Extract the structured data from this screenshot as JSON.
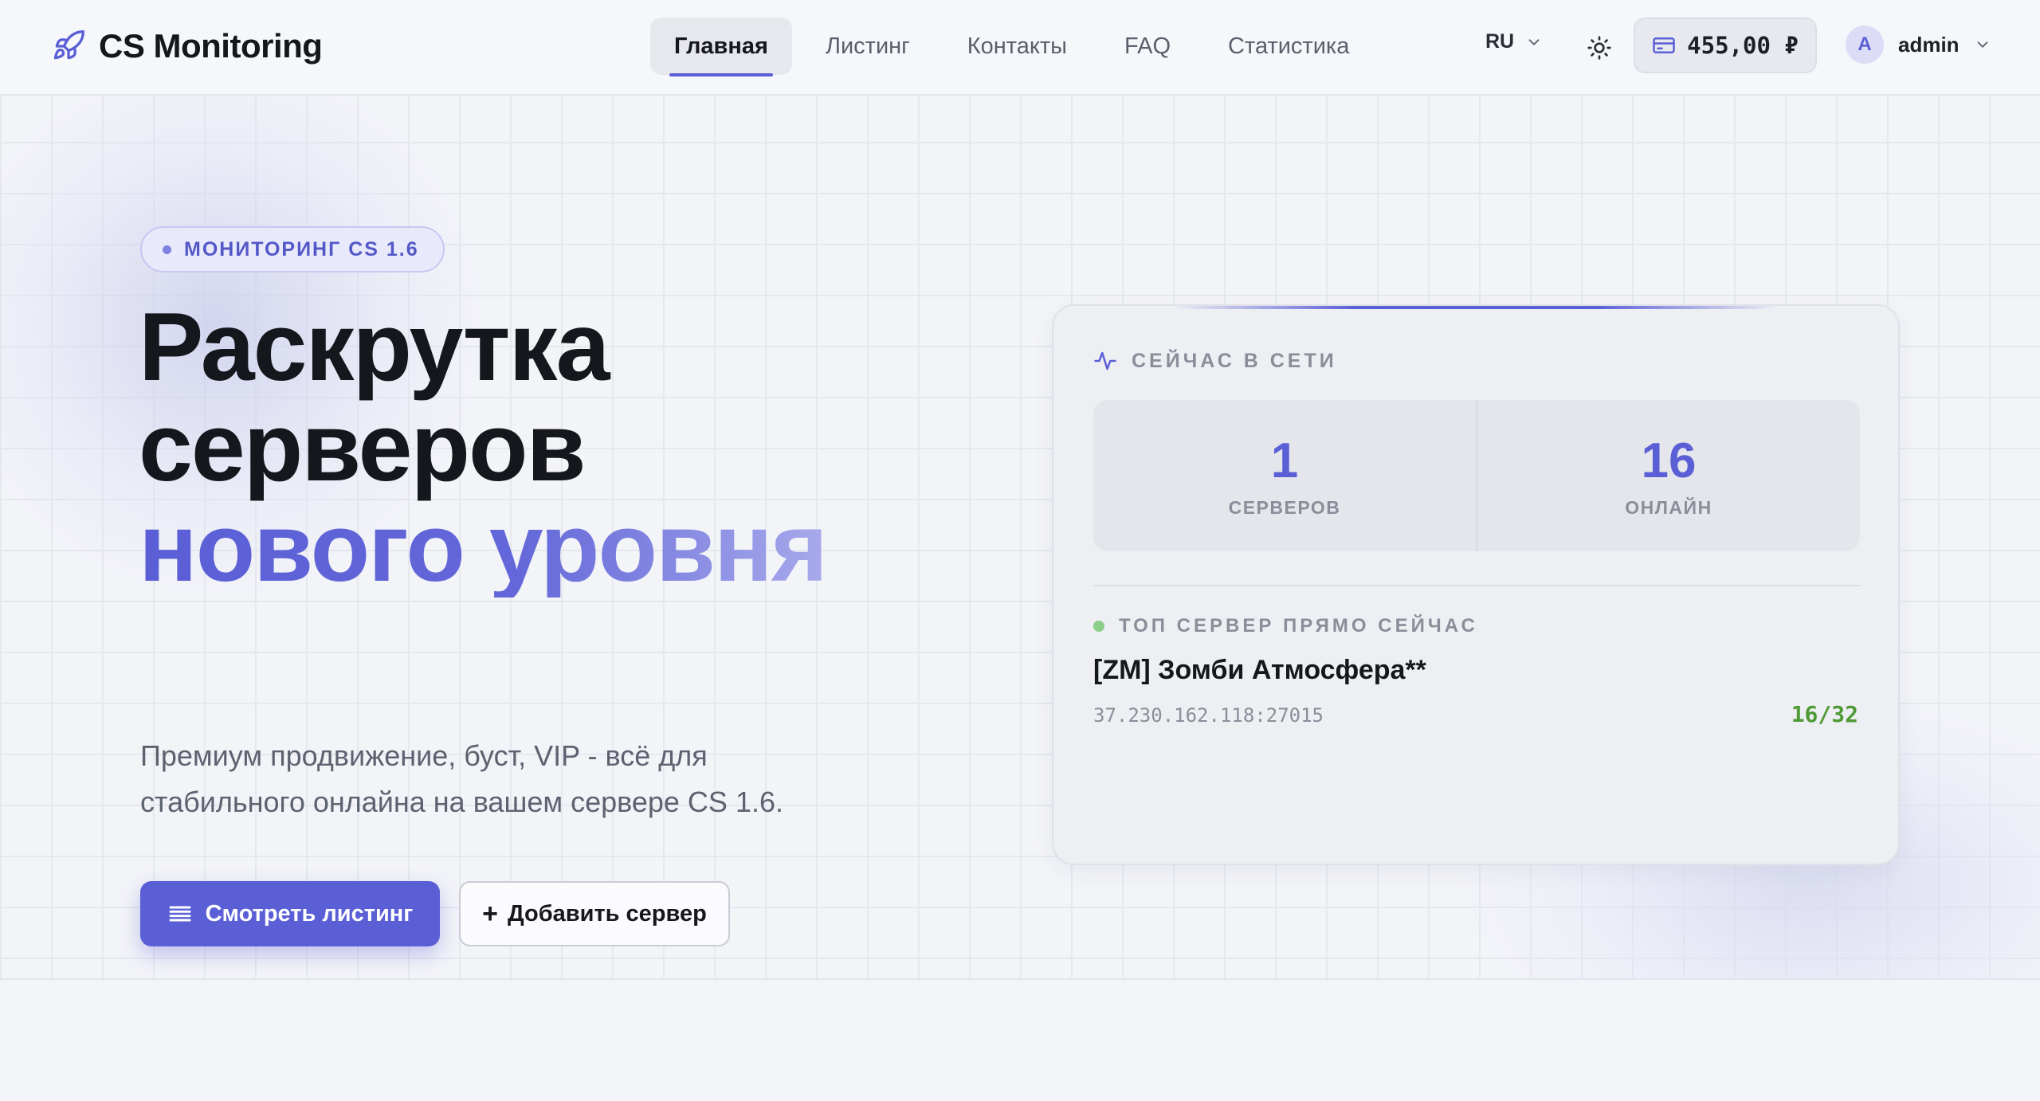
{
  "brand": {
    "name": "CS Monitoring"
  },
  "nav": {
    "items": [
      {
        "label": "Главная",
        "active": true
      },
      {
        "label": "Листинг",
        "active": false
      },
      {
        "label": "Контакты",
        "active": false
      },
      {
        "label": "FAQ",
        "active": false
      },
      {
        "label": "Статистика",
        "active": false
      }
    ]
  },
  "header": {
    "language": "RU",
    "balance": "455,00 ₽",
    "user": {
      "avatar_letter": "A",
      "name": "admin"
    }
  },
  "hero": {
    "badge": "МОНИТОРИНГ CS 1.6",
    "title_line1": "Раскрутка",
    "title_line2": "серверов",
    "title_line3": "нового уровня",
    "subtitle_line1": "Премиум продвижение, буст, VIP - всё для",
    "subtitle_line2": "стабильного онлайна на вашем сервере CS 1.6.",
    "primary_button": "Смотреть листинг",
    "secondary_button": "Добавить сервер"
  },
  "online_card": {
    "header": "СЕЙЧАС В СЕТИ",
    "stats": [
      {
        "value": "1",
        "label": "СЕРВЕРОВ"
      },
      {
        "value": "16",
        "label": "ОНЛАЙН"
      }
    ],
    "top_label": "ТОП СЕРВЕР ПРЯМО СЕЙЧАС",
    "top_server": {
      "name": "[ZM] Зомби Атмосфера**",
      "address": "37.230.162.118:27015",
      "players": "16/32"
    }
  },
  "colors": {
    "accent": "#5b5fd6",
    "online_green": "#4e9a35",
    "background": "#f3f4f8"
  }
}
